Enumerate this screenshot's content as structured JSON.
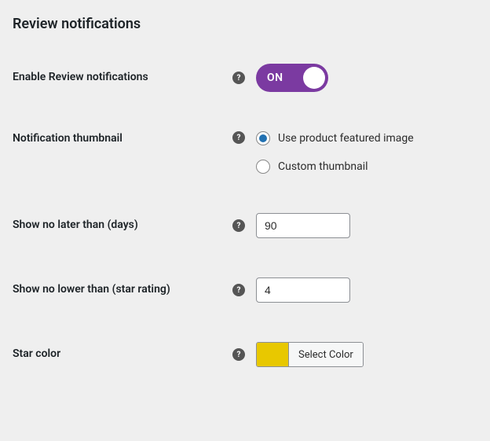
{
  "section_title": "Review notifications",
  "rows": {
    "enable": {
      "label": "Enable Review notifications",
      "toggle_text": "ON"
    },
    "thumbnail": {
      "label": "Notification thumbnail",
      "options": {
        "featured": "Use product featured image",
        "custom": "Custom thumbnail"
      }
    },
    "days": {
      "label": "Show no later than (days)",
      "value": "90"
    },
    "rating": {
      "label": "Show no lower than (star rating)",
      "value": "4"
    },
    "star_color": {
      "label": "Star color",
      "button": "Select Color",
      "swatch": "#e8c800"
    }
  }
}
